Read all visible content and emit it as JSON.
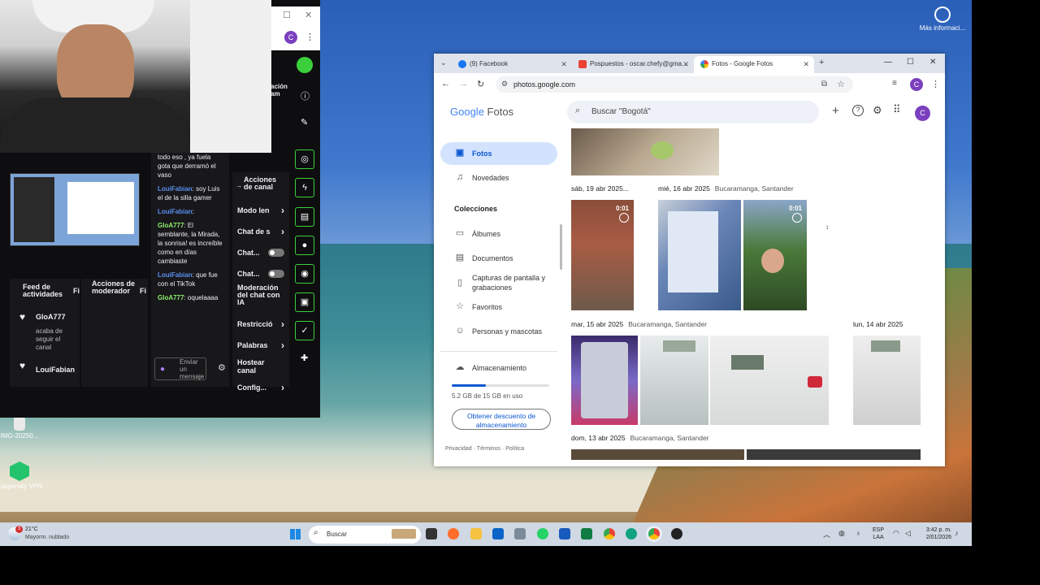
{
  "desktop": {
    "top_right_icon_label": "Más informaci...",
    "file_icon_label": "IMG-20250...",
    "vpn_icon_label": "Kaspersky VPN"
  },
  "stream_window": {
    "panels": {
      "activity_feed": {
        "title": "Feed de actividades",
        "filter": "Fi",
        "items": [
          {
            "user": "GloA777",
            "text": "acaba de seguir el canal"
          },
          {
            "user": "LouiFabian",
            "text": ""
          }
        ]
      },
      "mod_actions": {
        "title": "Acciones de moderador",
        "filter": "Fi"
      },
      "chat": {
        "messages": [
          {
            "user": "",
            "text": "todo eso , ya fuela gota que derramó el vaso",
            "color": "none"
          },
          {
            "user": "LouiFabian",
            "text": ": soy Luis el de la silla gamer",
            "color": "blue"
          },
          {
            "user": "LouiFabian",
            "text": ":",
            "color": "blue"
          },
          {
            "user": "GloA777",
            "text": ": El semblante, la Mirada, la sonrisa! es increíble como en días cambiaste",
            "color": "green"
          },
          {
            "user": "LouiFabian",
            "text": ": que fue con el TikTok",
            "color": "blue"
          },
          {
            "user": "GloA777",
            "text": ": oquelaaaa",
            "color": "green"
          }
        ],
        "input_placeholder": "Enviar un mensaje"
      },
      "channel_actions": {
        "title": "Acciones de canal",
        "partial_top": "ación am",
        "rows": [
          {
            "label": "Modo len",
            "control": "chevron"
          },
          {
            "label": "Chat de s",
            "control": "chevron"
          },
          {
            "label": "Chat...",
            "control": "toggle"
          },
          {
            "label": "Chat...",
            "control": "toggle"
          },
          {
            "label": "Moderación del chat con IA",
            "control": "none"
          },
          {
            "label": "Restricció",
            "control": "chevron"
          },
          {
            "label": "Palabras",
            "control": "chevron"
          },
          {
            "label": "Hostear canal",
            "control": "none"
          },
          {
            "label": "Config...",
            "control": "chevron"
          }
        ]
      }
    }
  },
  "chrome": {
    "tabs": [
      {
        "label": "(9) Facebook",
        "active": false
      },
      {
        "label": "Pospuestos - oscar.chefy@gma...",
        "active": false
      },
      {
        "label": "Fotos - Google Fotos",
        "active": true
      }
    ],
    "url": "photos.google.com",
    "profile_initial": "C"
  },
  "google_photos": {
    "logo_google": "Google",
    "logo_fotos": "Fotos",
    "search_placeholder": "Buscar \"Bogotá\"",
    "sidebar": {
      "items": [
        {
          "label": "Fotos",
          "active": true,
          "icon": "photo-icon"
        },
        {
          "label": "Novedades",
          "active": false,
          "icon": "bell-icon"
        }
      ],
      "collections_title": "Colecciones",
      "collections": [
        {
          "label": "Álbumes",
          "icon": "album-icon"
        },
        {
          "label": "Documentos",
          "icon": "document-icon"
        },
        {
          "label": "Capturas de pantalla y grabaciones",
          "icon": "phone-icon"
        },
        {
          "label": "Favoritos",
          "icon": "star-icon"
        },
        {
          "label": "Personas y mascotas",
          "icon": "face-icon"
        }
      ],
      "storage_label": "Almacenamiento",
      "storage_used": "5.2 GB de 15 GB en uso",
      "storage_fraction": 0.347,
      "discount_button": "Obtener descuento de almacenamiento",
      "footer": [
        "Privacidad",
        "Términos",
        "Política"
      ]
    },
    "groups": [
      {
        "date": "sáb, 19 abr 2025...",
        "location": ""
      },
      {
        "date": "mié, 16 abr 2025",
        "location": "Bucaramanga, Santander"
      },
      {
        "date": "mar, 15 abr 2025",
        "location": "Bucaramanga, Santander"
      },
      {
        "date": "lun, 14 abr 2025",
        "location": ""
      },
      {
        "date": "dom, 13 abr 2025",
        "location": "Bucaramanga, Santander"
      }
    ],
    "video_durations": [
      "0:01",
      "0:01"
    ]
  },
  "taskbar": {
    "weather_temp": "21°C",
    "weather_desc": "Mayorm. nublado",
    "weather_badge": "3",
    "search_label": "Buscar",
    "lang": "ESP",
    "lang_sub": "LAA",
    "time": "3:42 p. m.",
    "date": "2/01/2026"
  }
}
